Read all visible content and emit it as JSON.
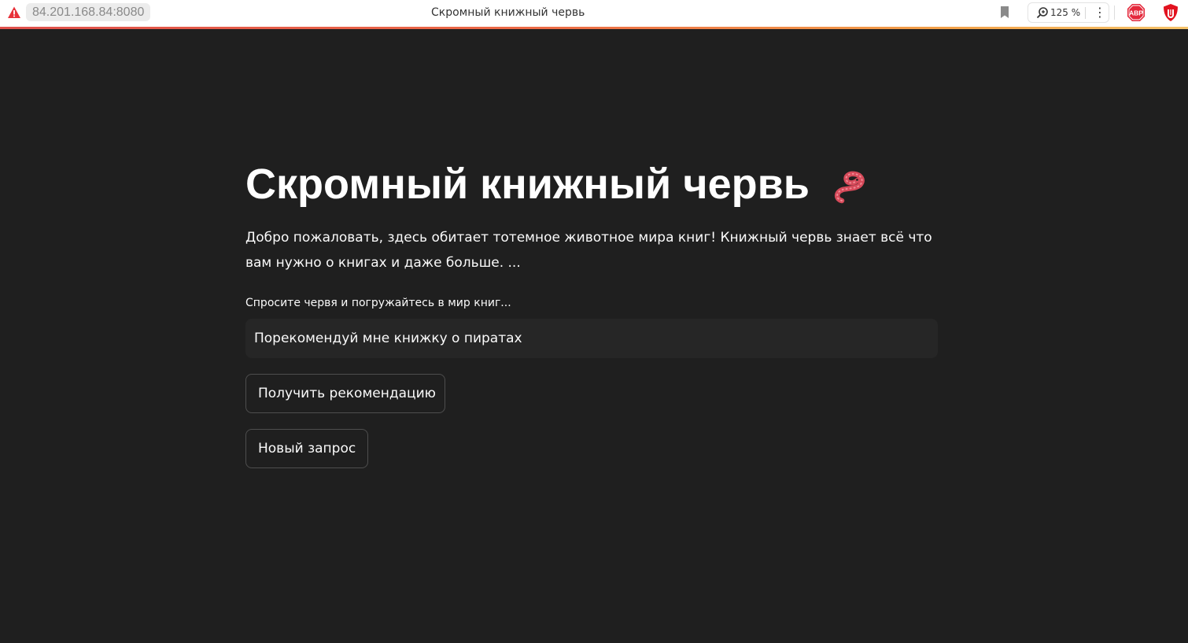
{
  "browser": {
    "url": "84.201.168.84:8080",
    "tab_title": "Скромный книжный червь",
    "zoom_label": "125 %",
    "menu_glyph": "⋮",
    "icons": {
      "security": "warning-icon",
      "bookmark": "bookmark-icon",
      "zoom": "zoom-icon",
      "extension_1": "adblock-plus-icon",
      "extension_2": "ublock-icon"
    },
    "colors": {
      "accent_start": "#e0514c",
      "accent_end": "#f5c36a"
    }
  },
  "page": {
    "title": "Скромный книжный червь",
    "title_icon": "worm-icon",
    "intro": "Добро пожаловать, здесь обитает тотемное животное мира книг! Книжный червь знает всё что вам нужно о книгах и даже больше. ...",
    "input_label": "Спросите червя и погружайтесь в мир книг...",
    "input_value": "Порекомендуй мне книжку о пиратах",
    "recommend_button": "Получить рекомендацию",
    "new_query_button": "Новый запрос",
    "colors": {
      "background": "#1f1f1f",
      "input_background": "#262626",
      "text": "#fafafa",
      "button_border": "#4e4e4e"
    }
  }
}
